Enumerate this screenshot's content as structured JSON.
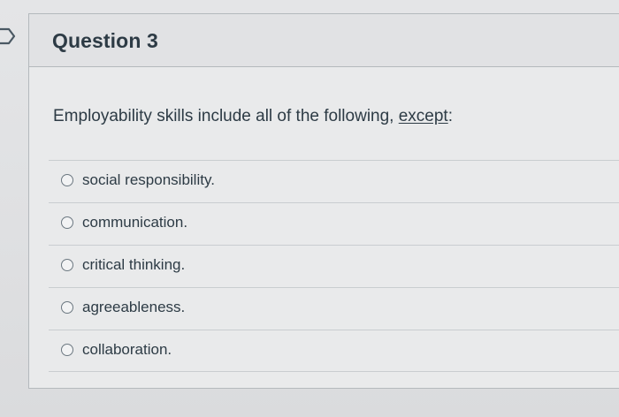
{
  "question": {
    "title": "Question 3",
    "prompt_main": "Employability skills include all of the following, ",
    "prompt_emphasis": "except",
    "prompt_end": ":",
    "answers": [
      {
        "label": "social responsibility."
      },
      {
        "label": "communication."
      },
      {
        "label": "critical thinking."
      },
      {
        "label": "agreeableness."
      },
      {
        "label": "collaboration."
      }
    ]
  },
  "icons": {
    "flag_marker": "question-flag-icon",
    "radio": "radio-unchecked-icon"
  },
  "colors": {
    "text": "#2d3b45",
    "border": "#b4b9bd",
    "radio_border": "#6b7780"
  }
}
